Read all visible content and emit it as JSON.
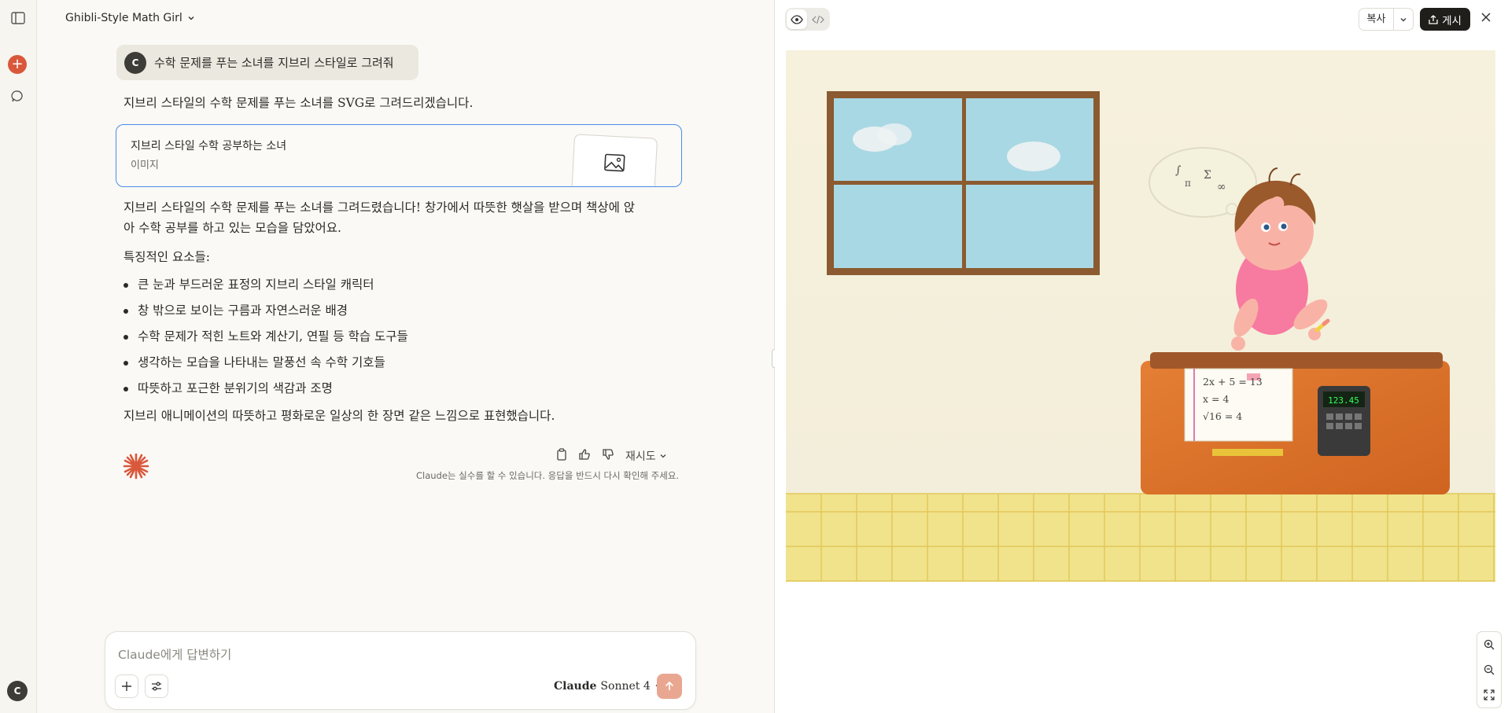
{
  "chat": {
    "title": "Ghibli-Style Math Girl",
    "user": {
      "initial": "C",
      "message": "수학 문제를 푸는 소녀를 지브리 스타일로 그려줘"
    },
    "intro": "지브리 스타일의 수학 문제를 푸는 소녀를 SVG로 그려드리겠습니다.",
    "artifact": {
      "title": "지브리 스타일 수학 공부하는 소녀",
      "type": "이미지"
    },
    "summary_line1": "지브리 스타일의 수학 문제를 푸는 소녀를 그려드렸습니다! 창가에서 따뜻한 햇살을 받으며 책상에 앉",
    "summary_line2": "아 수학 공부를 하고 있는 모습을 담았어요.",
    "features_heading": "특징적인 요소들:",
    "features": [
      "큰 눈과 부드러운 표정의 지브리 스타일 캐릭터",
      "창 밖으로 보이는 구름과 자연스러운 배경",
      "수학 문제가 적힌 노트와 계산기, 연필 등 학습 도구들",
      "생각하는 모습을 나타내는 말풍선 속 수학 기호들",
      "따뜻하고 포근한 분위기의 색감과 조명"
    ],
    "closing": "지브리 애니메이션의 따뜻하고 평화로운 일상의 한 장면 같은 느낌으로 표현했습니다.",
    "retry_label": "재시도",
    "disclaimer": "Claude는 실수를 할 수 있습니다. 응답을 반드시 다시 확인해 주세요.",
    "composer": {
      "placeholder": "Claude에게 답변하기",
      "model_brand": "Claude",
      "model_version": "Sonnet 4"
    }
  },
  "sidebar": {
    "user_initial": "C"
  },
  "panel": {
    "copy_label": "복사",
    "publish_label": "게시",
    "drawing": {
      "equations": [
        "2x + 5 = 13",
        "x = 4",
        "√16 = 4"
      ],
      "calculator_display": "123.45",
      "thought_symbols": [
        "∫",
        "π",
        "Σ",
        "∞"
      ]
    }
  },
  "colors": {
    "accent": "#d9583b",
    "selection": "#4a8de8",
    "send": "#e9a791"
  }
}
